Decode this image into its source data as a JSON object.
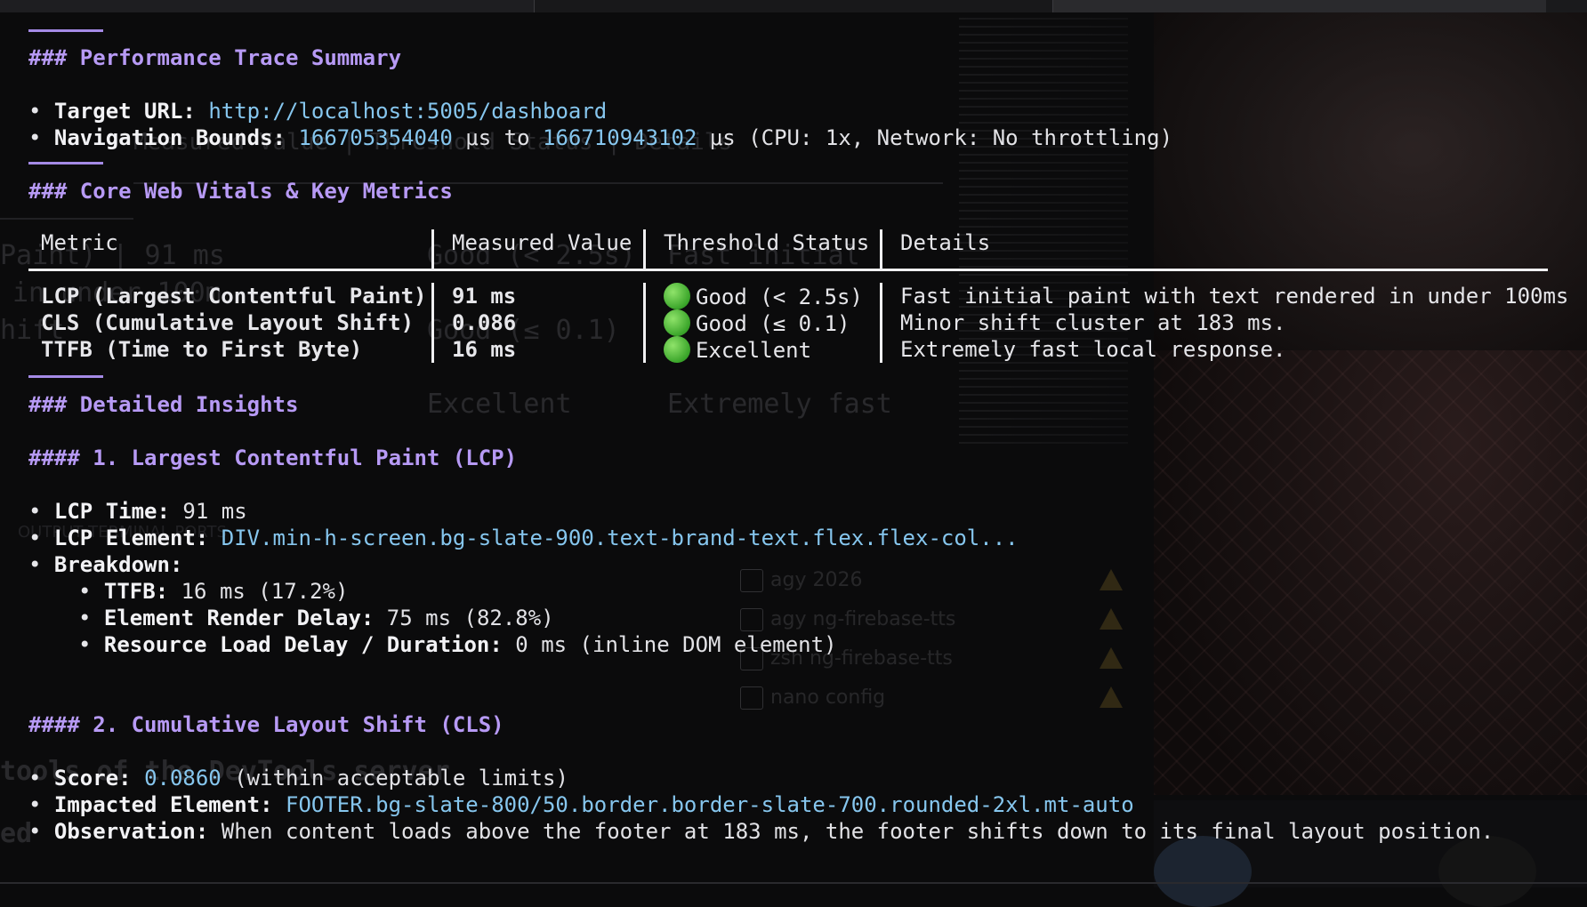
{
  "summary": {
    "heading": "### Performance Trace Summary",
    "target_url_label": "Target URL:",
    "target_url": "http://localhost:5005/dashboard",
    "nav_bounds_label": "Navigation Bounds:",
    "nav_bounds_start": "166705354040",
    "nav_bounds_mid": " μs to ",
    "nav_bounds_end": "166710943102",
    "nav_bounds_rest": " μs (CPU: 1x, Network: No throttling)"
  },
  "vitals": {
    "heading": "### Core Web Vitals & Key Metrics",
    "columns": [
      "Metric",
      "Measured Value",
      "Threshold Status",
      "Details"
    ],
    "rows": [
      {
        "metric": "LCP (Largest Contentful Paint)",
        "value": "91 ms",
        "status": "Good (< 2.5s)",
        "details": "Fast initial paint with text rendered in under 100ms"
      },
      {
        "metric": "CLS (Cumulative Layout Shift)",
        "value": "0.086",
        "status": "Good (≤ 0.1)",
        "details": "Minor shift cluster at 183 ms."
      },
      {
        "metric": "TTFB (Time to First Byte)",
        "value": "16 ms",
        "status": "Excellent",
        "details": "Extremely fast local response."
      }
    ]
  },
  "insights": {
    "heading": "### Detailed Insights",
    "lcp": {
      "heading": "#### 1. Largest Contentful Paint (LCP)",
      "time_label": "LCP Time:",
      "time_value": "91 ms",
      "element_label": "LCP Element:",
      "element_value": "DIV.min-h-screen.bg-slate-900.text-brand-text.flex.flex-col...",
      "breakdown_label": "Breakdown:",
      "ttfb_label": "TTFB:",
      "ttfb_value": "16 ms (17.2%)",
      "render_label": "Element Render Delay:",
      "render_value": "75 ms (82.8%)",
      "resource_label": "Resource Load Delay / Duration:",
      "resource_value": "0 ms (inline DOM element)"
    },
    "cls": {
      "heading": "#### 2. Cumulative Layout Shift (CLS)",
      "score_label": "Score:",
      "score_value": "0.0860",
      "score_rest": " (within acceptable limits)",
      "impacted_label": "Impacted Element:",
      "impacted_value": "FOOTER.bg-slate-800/50.border.border-slate-700.rounded-2xl.mt-auto",
      "observation_label": "Observation:",
      "observation_value": "When content loads above the footer at 183 ms, the footer shifts down to its final layout position."
    }
  },
  "background": {
    "ghost_table_1": "Paint) | 91 ms",
    "ghost_table_2": "Good (< 2.5s)",
    "ghost_table_3": "Fast initial",
    "ghost_table_4": "in under 100m",
    "ghost_table_5": "hift",
    "ghost_table_6": "Good (≤ 0.1)",
    "ghost_table_7": "Excellent",
    "ghost_table_8": "Extremely fast",
    "ghost_header": "Measured Value | Threshold Status | Details",
    "ghost_panel_tabs": "OUTPUT   TERMINAL   PORTS",
    "ghost_tools": "tools of the DevTools server",
    "ghost_ed": "ed",
    "ghost_list": [
      {
        "cmd": "agy",
        "arg": "2026"
      },
      {
        "cmd": "agy",
        "arg": "ng-firebase-tts"
      },
      {
        "cmd": "zsh",
        "arg": "ng-firebase-tts"
      },
      {
        "cmd": "nano",
        "arg": "config"
      }
    ]
  }
}
